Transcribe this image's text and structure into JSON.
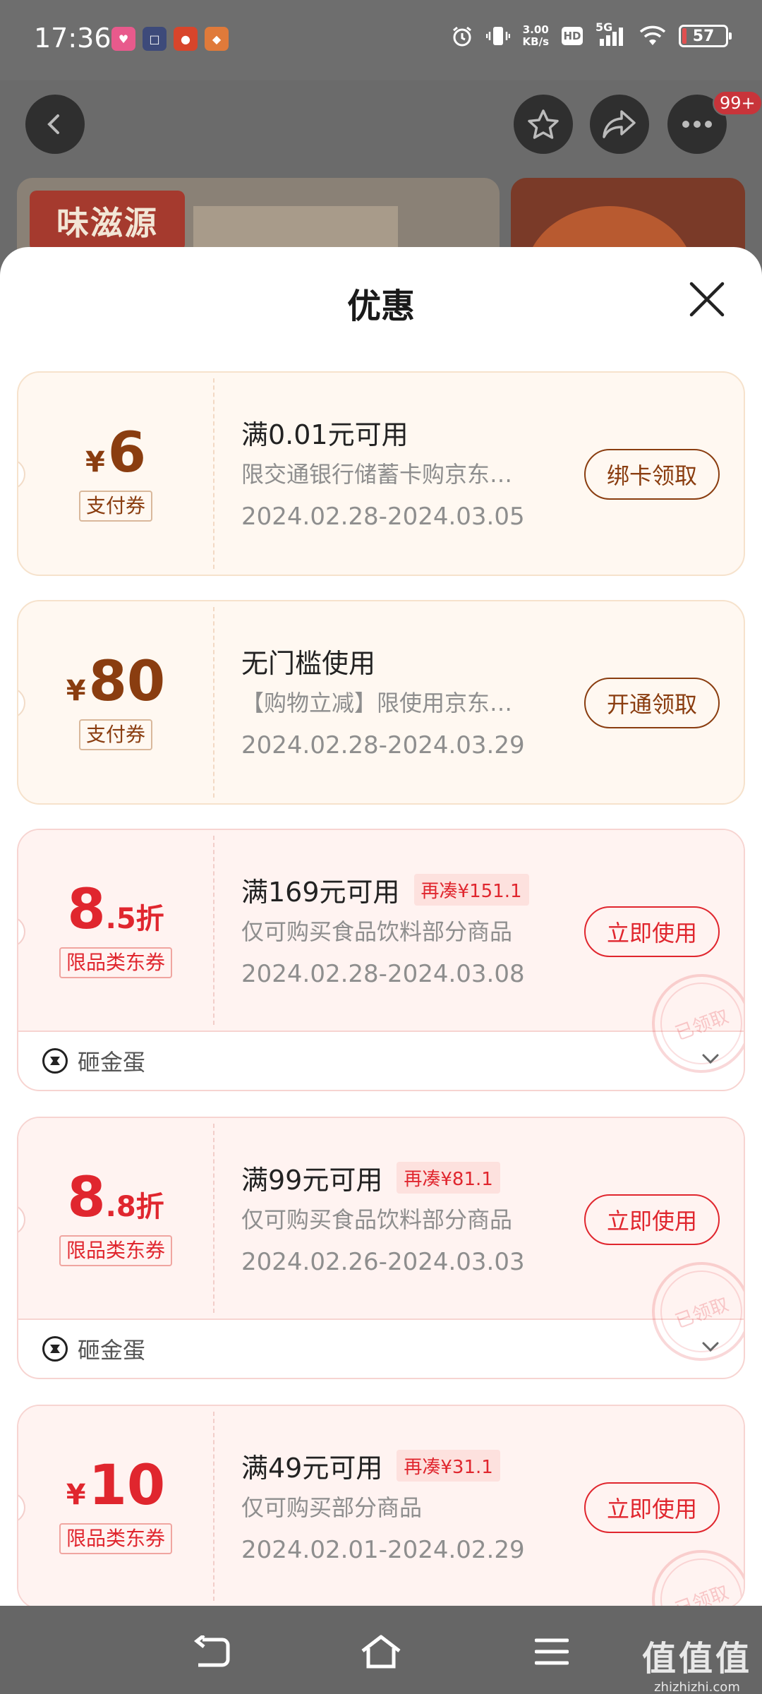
{
  "status_bar": {
    "time": "17:36",
    "net_speed_value": "3.00",
    "net_speed_unit": "KB/s",
    "hd": "HD",
    "network": "5G",
    "battery": "57"
  },
  "header": {
    "notification_badge": "99+",
    "shop_logo_text": "味滋源"
  },
  "sheet": {
    "title": "优惠",
    "coupons": [
      {
        "currency": "¥",
        "amount": "6",
        "tag": "支付券",
        "condition": "满0.01元可用",
        "description": "限交通银行储蓄卡购京东…",
        "date_range": "2024.02.28-2024.03.05",
        "action": "绑卡领取"
      },
      {
        "currency": "¥",
        "amount": "80",
        "tag": "支付券",
        "condition": "无门槛使用",
        "description": "【购物立减】限使用京东…",
        "date_range": "2024.02.28-2024.03.29",
        "action": "开通领取"
      },
      {
        "amount_main": "8",
        "amount_sub": ".5折",
        "tag": "限品类东券",
        "condition": "满169元可用",
        "still_need": "再凑¥151.1",
        "description": "仅可购买食品饮料部分商品",
        "date_range": "2024.02.28-2024.03.08",
        "action": "立即使用",
        "stamp": "已领取",
        "extra": "砸金蛋"
      },
      {
        "amount_main": "8",
        "amount_sub": ".8折",
        "tag": "限品类东券",
        "condition": "满99元可用",
        "still_need": "再凑¥81.1",
        "description": "仅可购买食品饮料部分商品",
        "date_range": "2024.02.26-2024.03.03",
        "action": "立即使用",
        "stamp": "已领取",
        "extra": "砸金蛋"
      },
      {
        "currency": "¥",
        "amount": "10",
        "tag": "限品类东券",
        "condition": "满49元可用",
        "still_need": "再凑¥31.1",
        "description": "仅可购买部分商品",
        "date_range": "2024.02.01-2024.02.29",
        "action": "立即使用",
        "stamp": "已领取"
      }
    ]
  },
  "watermark": {
    "main": "值值值",
    "domain": "zhizhizhi.com"
  },
  "colors": {
    "gold": "#8a3d10",
    "red": "#e0262e"
  }
}
